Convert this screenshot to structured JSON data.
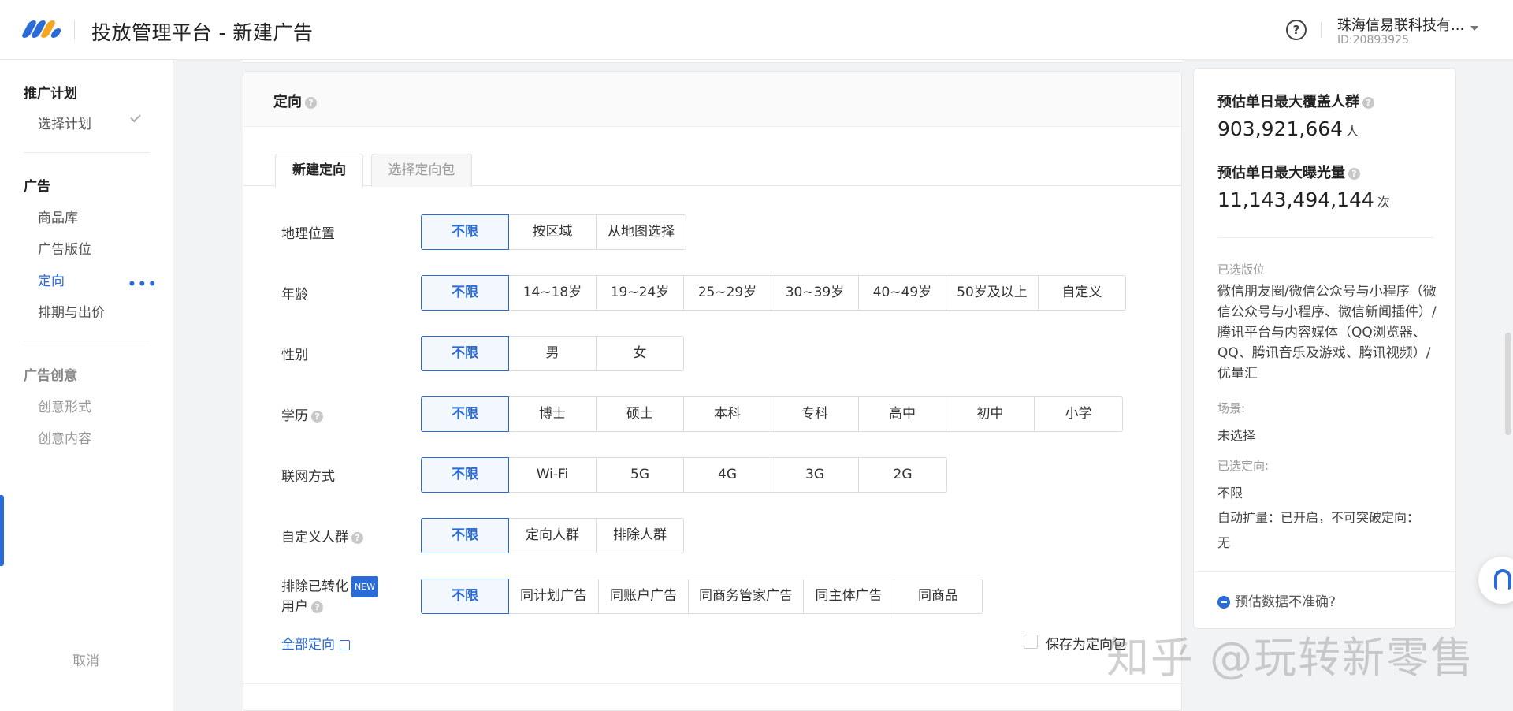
{
  "header": {
    "title": "投放管理平台 - 新建广告",
    "help": "?",
    "account_name": "珠海信易联科技有...",
    "account_id": "ID:20893925"
  },
  "colors": {
    "accent": "#2a6bd8"
  },
  "sidebar": {
    "group1": "推广计划",
    "item_select_plan": "选择计划",
    "group2": "广告",
    "item_products": "商品库",
    "item_placement": "广告版位",
    "item_targeting": "定向",
    "item_targeting_more": "•••",
    "item_schedule": "排期与出价",
    "group3": "广告创意",
    "item_creative_form": "创意形式",
    "item_creative_content": "创意内容",
    "cancel": "取消"
  },
  "card": {
    "title": "定向",
    "tabs": [
      "新建定向",
      "选择定向包"
    ]
  },
  "rows": {
    "geo": {
      "label": "地理位置",
      "options": [
        "不限",
        "按区域",
        "从地图选择"
      ]
    },
    "age": {
      "label": "年龄",
      "options": [
        "不限",
        "14~18岁",
        "19~24岁",
        "25~29岁",
        "30~39岁",
        "40~49岁",
        "50岁及以上",
        "自定义"
      ]
    },
    "gender": {
      "label": "性别",
      "options": [
        "不限",
        "男",
        "女"
      ]
    },
    "education": {
      "label": "学历",
      "options": [
        "不限",
        "博士",
        "硕士",
        "本科",
        "专科",
        "高中",
        "初中",
        "小学"
      ]
    },
    "network": {
      "label": "联网方式",
      "options": [
        "不限",
        "Wi-Fi",
        "5G",
        "4G",
        "3G",
        "2G"
      ]
    },
    "custom_audience": {
      "label": "自定义人群",
      "options": [
        "不限",
        "定向人群",
        "排除人群"
      ]
    },
    "exclude_converted": {
      "label_line1": "排除已转化",
      "badge": "NEW",
      "label_line2": "用户",
      "options": [
        "不限",
        "同计划广告",
        "同账户广告",
        "同商务管家广告",
        "同主体广告",
        "同商品"
      ]
    }
  },
  "footer": {
    "all_targeting": "全部定向",
    "save_as_package": "保存为定向包"
  },
  "right_panel": {
    "reach_label": "预估单日最大覆盖人群",
    "reach_value": "903,921,664",
    "reach_unit": "人",
    "impressions_label": "预估单日最大曝光量",
    "impressions_value": "11,143,494,144",
    "impressions_unit": "次",
    "placement_label": "已选版位",
    "placement_value": "微信朋友圈/微信公众号与小程序（微信公众号与小程序、微信新闻插件）/腾讯平台与内容媒体（QQ浏览器、QQ、腾讯音乐及游戏、腾讯视频）/优量汇",
    "scene_label": "场景:",
    "scene_value": "未选择",
    "targeting_label": "已选定向:",
    "targeting_value": "不限",
    "auto_expand": "自动扩量：已开启，不可突破定向：",
    "auto_expand_value": "无",
    "inaccurate": "预估数据不准确?"
  },
  "watermark": "知乎 @玩转新零售"
}
